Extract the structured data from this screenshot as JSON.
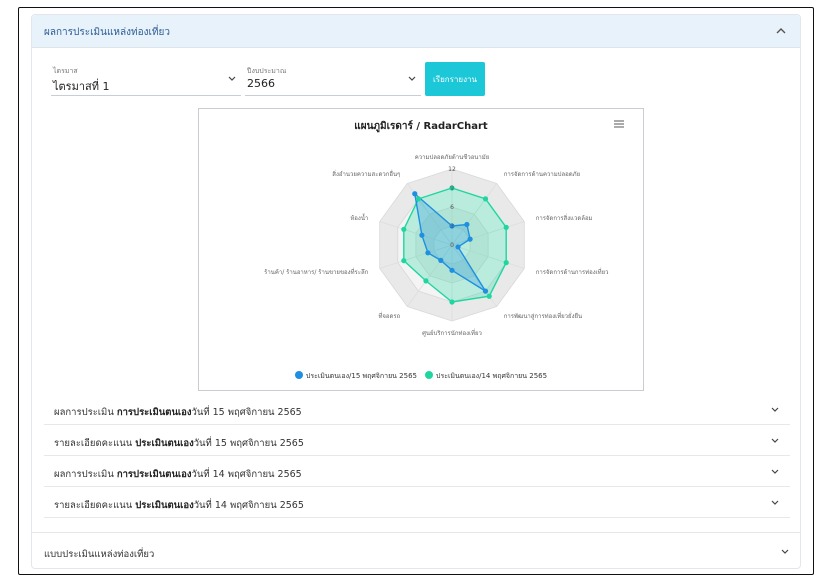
{
  "panel": {
    "title": "ผลการประเมินแหล่งท่องเที่ยว"
  },
  "filters": {
    "region": {
      "label": "ไตรมาส",
      "value": "ไตรมาสที่ 1"
    },
    "year": {
      "label": "ปีงบประมาณ",
      "value": "2566"
    },
    "report_button": "เรียกรายงาน"
  },
  "chart_data": {
    "type": "radar",
    "title": "แผนภูมิเรดาร์ / RadarChart",
    "axes": [
      "ความปลอดภัยด้านชีวอนามัย",
      "การจัดการด้านความปลอดภัย",
      "การจัดการสิ่งแวดล้อม",
      "การจัดการด้านการท่องเที่ยว",
      "การพัฒนาสู่การท่องเที่ยวยั่งยืน",
      "ศูนย์บริการนักท่องเที่ยว",
      "ที่จอดรถ",
      "ร้านค้า/ ร้านอาหาร/ ร้านขายของที่ระลึก",
      "ห้องน้ำ",
      "สิ่งอำนวยความสะดวกอื่นๆ"
    ],
    "ticks": [
      "0",
      "3",
      "6",
      "9",
      "12"
    ],
    "rmax": 12,
    "series": [
      {
        "name": "ประเมินตนเอง/15 พฤศจิกายน 2565",
        "color": "#1f8fe0",
        "values": [
          3,
          4,
          3,
          1,
          9,
          4,
          3,
          4,
          5,
          10
        ]
      },
      {
        "name": "ประเมินตนเอง/14 พฤศจิกายน 2565",
        "color": "#1fd6a0",
        "values": [
          9,
          9,
          9,
          9,
          10,
          9,
          7,
          8,
          8,
          9
        ]
      }
    ]
  },
  "rows": [
    {
      "prefix": "ผลการประเมิน ",
      "bold": "การประเมินตนเอง",
      "suffix": "วันที่ 15 พฤศจิกายน 2565"
    },
    {
      "prefix": "รายละเอียดคะแนน ",
      "bold": "ประเมินตนเอง",
      "suffix": "วันที่ 15 พฤศจิกายน 2565"
    },
    {
      "prefix": "ผลการประเมิน ",
      "bold": "การประเมินตนเอง",
      "suffix": "วันที่ 14 พฤศจิกายน 2565"
    },
    {
      "prefix": "รายละเอียดคะแนน ",
      "bold": "ประเมินตนเอง",
      "suffix": "วันที่ 14 พฤศจิกายน 2565"
    }
  ],
  "bottom_section": {
    "title": "แบบประเมินแหล่งท่องเที่ยว"
  },
  "colors": {
    "header_bg": "#e8f2fb",
    "title": "#2e5c93",
    "accent": "#1cc7d8"
  }
}
